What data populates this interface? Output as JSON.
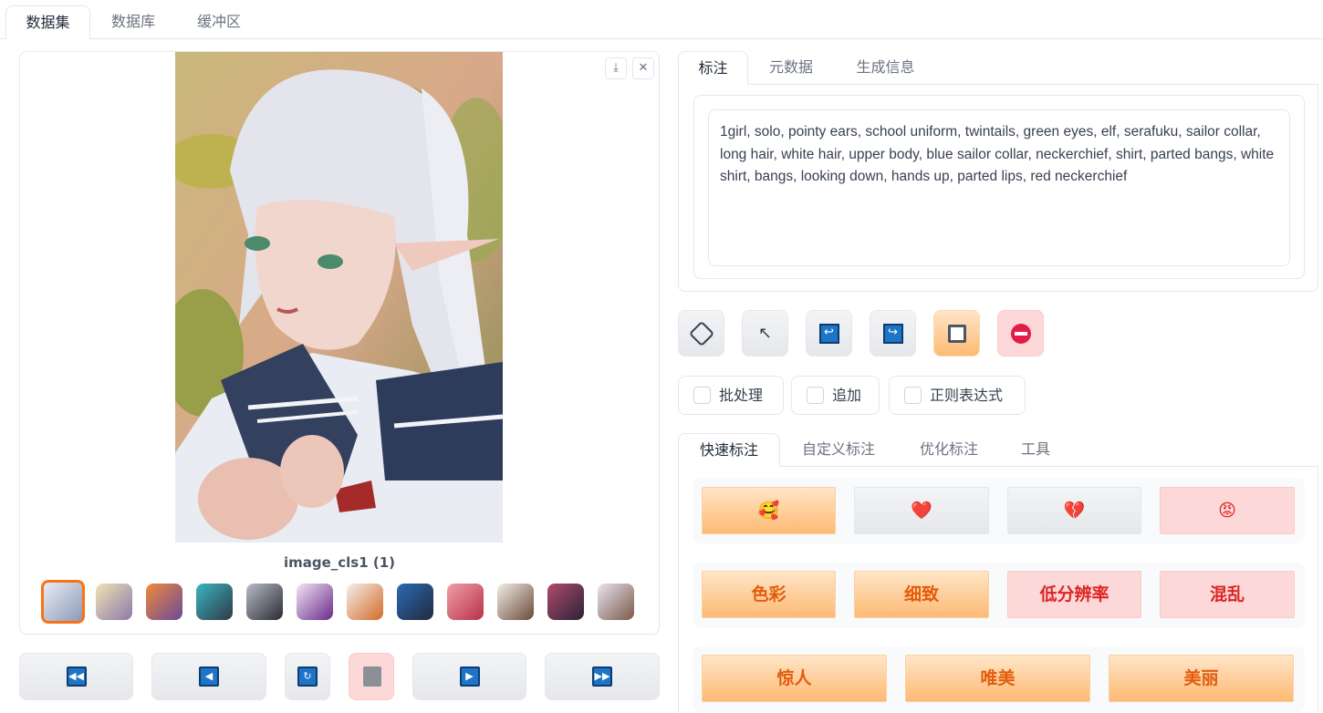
{
  "top_tabs": [
    "数据集",
    "数据库",
    "缓冲区"
  ],
  "viewer": {
    "caption": "image_cls1 (1)",
    "download_icon": "⤓",
    "close_icon": "✕",
    "thumb_count": 12
  },
  "nav_buttons": [
    "first-icon",
    "prev-icon",
    "refresh-icon",
    "trash-icon",
    "next-icon",
    "last-icon"
  ],
  "right_tabs": [
    "标注",
    "元数据",
    "生成信息"
  ],
  "caption_text": "1girl, solo, pointy ears, school uniform, twintails, green eyes, elf, serafuku, sailor collar, long hair, white hair, upper body, blue sailor collar, neckerchief, shirt, parted bangs, white shirt, bangs, looking down, hands up, parted lips, red neckerchief",
  "tool_buttons": [
    "dice-icon",
    "cursor-icon",
    "undo-icon",
    "redo-icon",
    "save-icon",
    "stop-icon"
  ],
  "checkboxes": [
    "批处理",
    "追加",
    "正则表达式"
  ],
  "quick_tabs": [
    "快速标注",
    "自定义标注",
    "优化标注",
    "工具"
  ],
  "quick_rows": {
    "emoji": [
      "🥰",
      "❤️",
      "💔",
      "😡"
    ],
    "quality": [
      "色彩",
      "细致",
      "低分辨率",
      "混乱"
    ],
    "beauty": [
      "惊人",
      "唯美",
      "美丽"
    ]
  },
  "colors": {
    "accent_orange": "#f97316",
    "blue_icon": "#1e74c6",
    "red_btn": "#fdd8d8"
  }
}
